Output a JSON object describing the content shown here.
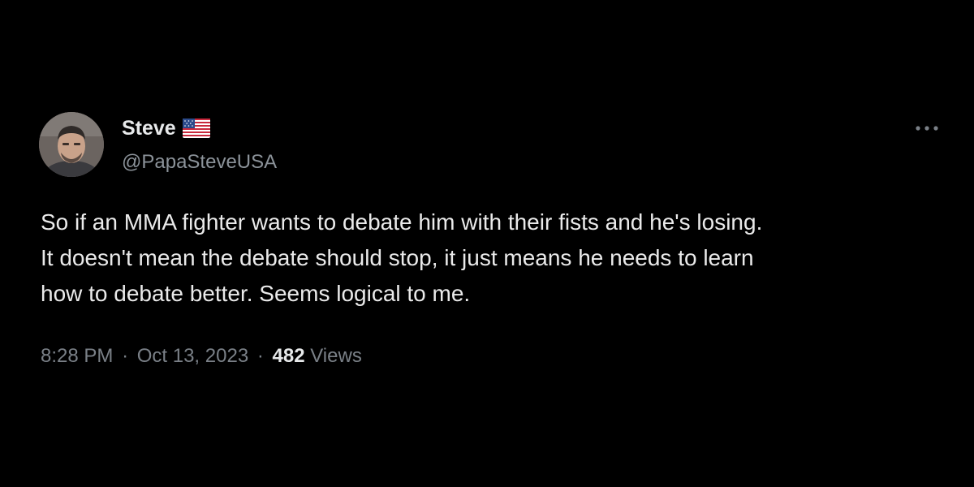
{
  "author": {
    "display_name": "Steve",
    "flag_icon": "us-flag-icon",
    "handle": "@PapaSteveUSA"
  },
  "tweet": {
    "text_lines": [
      "So if an MMA fighter wants to debate him with their fists and he's losing.",
      "It doesn't mean the debate should stop, it just means he needs to learn",
      "how to debate better. Seems logical to me."
    ]
  },
  "meta": {
    "time": "8:28 PM",
    "date": "Oct 13, 2023",
    "separator": "·",
    "views_count": "482",
    "views_label": "Views"
  },
  "icons": {
    "more": "more-horizontal-icon"
  },
  "colors": {
    "background": "#000000",
    "primary_text": "#e7e9ea",
    "secondary_text": "#7a8087"
  }
}
